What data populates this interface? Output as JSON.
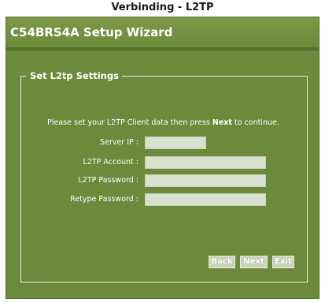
{
  "page": {
    "caption": "Verbinding - L2TP"
  },
  "wizard": {
    "title": "C54BRS4A Setup Wizard",
    "section_title": "Set L2tp Settings",
    "instruction_pre": "Please set your L2TP Client data then press ",
    "instruction_bold": "Next",
    "instruction_post": " to continue.",
    "fields": [
      {
        "label": "Server IP :",
        "value": ""
      },
      {
        "label": "L2TP Account :",
        "value": ""
      },
      {
        "label": "L2TP Password :",
        "value": ""
      },
      {
        "label": "Retype Password :",
        "value": ""
      }
    ],
    "buttons": {
      "back": "Back",
      "next": "Next",
      "exit": "Exit"
    }
  },
  "colors": {
    "background": "#6b8a3b",
    "input": "#d9e0cf",
    "button": "#cbd3b9",
    "text": "#ffffff"
  }
}
